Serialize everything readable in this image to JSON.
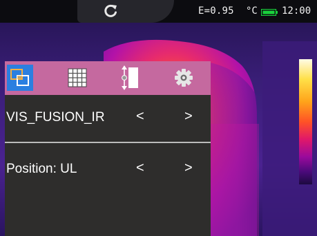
{
  "status": {
    "emissivity": "E=0.95",
    "unit": "°C",
    "time": "12:00",
    "icons": {
      "refresh": "refresh-icon",
      "battery": "battery-icon"
    },
    "battery_color": "#19d13c"
  },
  "toolbar": {
    "items": [
      {
        "icon": "fusion-icon",
        "active": true
      },
      {
        "icon": "grid-icon",
        "active": false
      },
      {
        "icon": "split-slider-icon",
        "active": false
      },
      {
        "icon": "gear-icon",
        "active": false
      }
    ],
    "active_color": "#2b7fe0",
    "bar_color": "#c5699f"
  },
  "menu": {
    "rows": [
      {
        "label": "VIS_FUSION_IR",
        "prev": "<",
        "next": ">"
      },
      {
        "label": "Position: UL",
        "prev": "<",
        "next": ">"
      }
    ]
  },
  "palette": [
    "#fffbe6",
    "#ffe048",
    "#ffa31a",
    "#ff5226",
    "#e0186a",
    "#9a0a9c",
    "#4a0a7a",
    "#1c0a40"
  ]
}
